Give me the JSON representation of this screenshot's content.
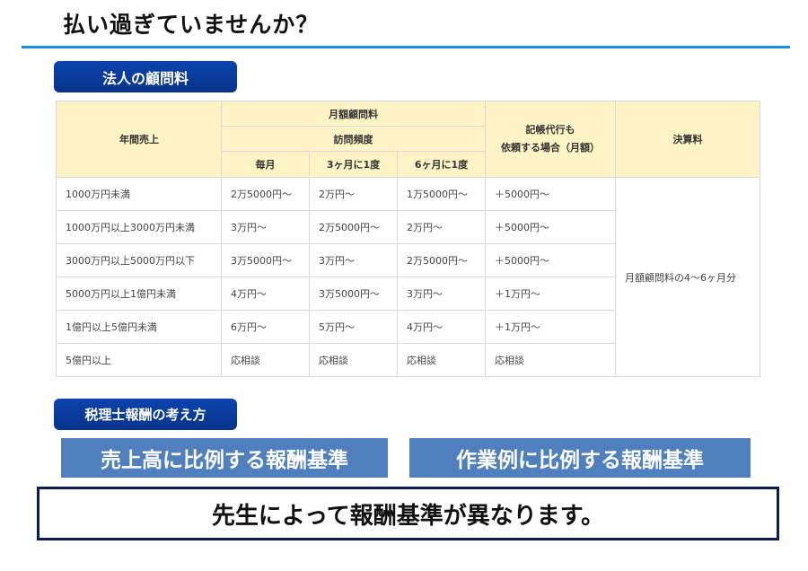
{
  "header": {
    "title": "払い過ぎていませんか？"
  },
  "corporate_section": {
    "label": "法人の顧問料",
    "table": {
      "headers": {
        "annual_sales": "年間売上",
        "monthly_fee": "月額顧問料",
        "visit_frequency": "訪問頻度",
        "every_month": "毎月",
        "every_3_months": "3ヶ月に1度",
        "every_6_months": "6ヶ月に1度",
        "bookkeeping_line1": "記帳代行も",
        "bookkeeping_line2": "依頼する場合（月額）",
        "settlement": "決算料"
      },
      "rows": [
        {
          "sales": "1000万円未満",
          "monthly": "2万5000円～",
          "quarterly": "2万円～",
          "semiannual": "1万5000円～",
          "bookkeeping": "＋5000円～"
        },
        {
          "sales": "1000万円以上3000万円未満",
          "monthly": "3万円～",
          "quarterly": "2万5000円～",
          "semiannual": "2万円～",
          "bookkeeping": "＋5000円～"
        },
        {
          "sales": "3000万円以上5000万円以下",
          "monthly": "3万5000円～",
          "quarterly": "3万円～",
          "semiannual": "2万5000円～",
          "bookkeeping": "＋5000円～"
        },
        {
          "sales": "5000万円以上1億円未満",
          "monthly": "4万円～",
          "quarterly": "3万5000円～",
          "semiannual": "3万円～",
          "bookkeeping": "＋1万円～"
        },
        {
          "sales": "1億円以上5億円未満",
          "monthly": "6万円～",
          "quarterly": "5万円～",
          "semiannual": "4万円～",
          "bookkeeping": "＋1万円～"
        },
        {
          "sales": "5億円以上",
          "monthly": "応相談",
          "quarterly": "応相談",
          "semiannual": "応相談",
          "bookkeeping": "応相談"
        }
      ],
      "settlement_value": "月額顧問料の4～6ヶ月分"
    }
  },
  "fee_concept_section": {
    "label": "税理士報酬の考え方",
    "left_band": "売上高に比例する報酬基準",
    "right_band": "作業例に比例する報酬基準"
  },
  "message": "先生によって報酬基準が異なります。"
}
